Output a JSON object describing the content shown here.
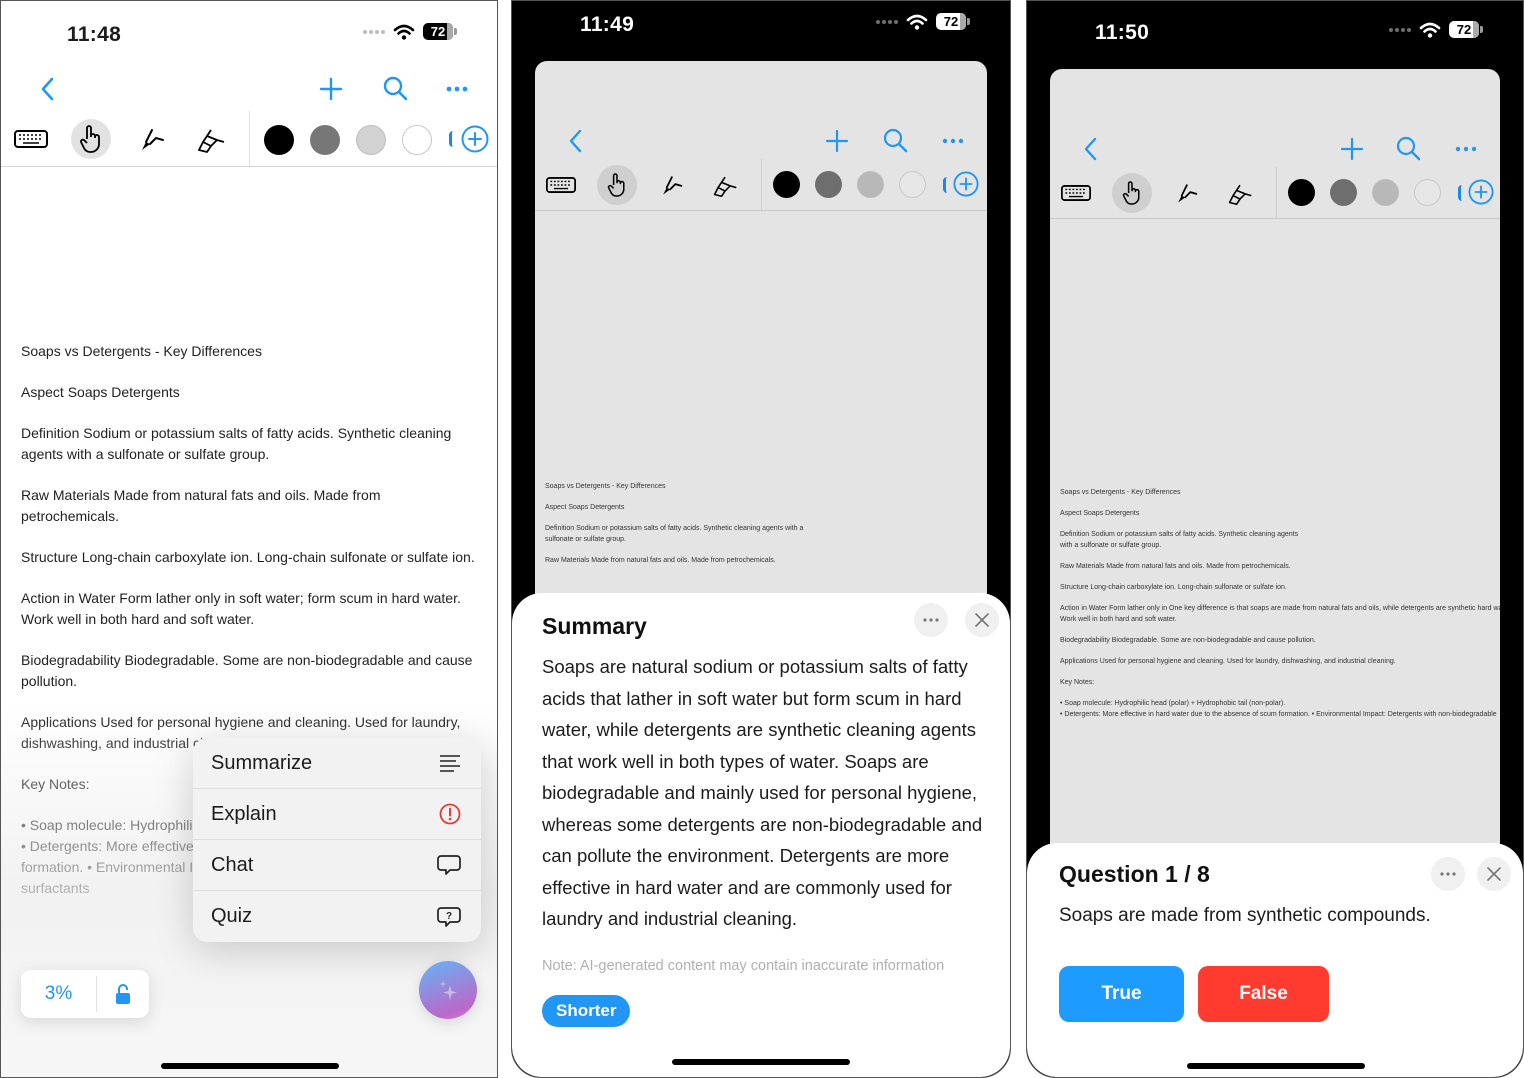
{
  "colors": {
    "accent": "#2196f3",
    "danger": "#ff3b30",
    "swatches": [
      "#000000",
      "#777777",
      "#cfcfcf",
      "#ffffff"
    ]
  },
  "document": {
    "title": "Soaps vs Detergents - Key Differences",
    "paragraphs": [
      "Soaps vs Detergents - Key Differences",
      "Aspect Soaps Detergents",
      "Definition Sodium or potassium salts of fatty acids. Synthetic cleaning agents with a sulfonate or sulfate group.",
      "Raw Materials Made from natural fats and oils. Made from petrochemicals.",
      "Structure Long-chain carboxylate ion. Long-chain sulfonate or sulfate ion.",
      "Action in Water Form lather only in soft water; form scum in hard water. Work well in both hard and soft water.",
      "Biodegradability Biodegradable. Some are non-biodegradable and cause pollution.",
      "Applications Used for personal hygiene and cleaning. Used for laundry, dishwashing, and industrial cleaning.",
      "Key Notes:",
      "• Soap molecule: Hydrophilic head (polar) + Hydrophobic tail (non-polar).\n• Detergents: More effective in hard water due to the absence of scum formation. • Environmental Impact: Detergents with non-biodegradable surfactants"
    ],
    "p3_paragraphs": [
      "Soaps vs Detergents - Key Differences",
      "Aspect Soaps Detergents",
      "Definition Sodium or potassium salts of fatty acids. Synthetic cleaning agents with a sulfonate or sulfate group.",
      "Raw Materials Made from natural fats and oils. Made from petrochemicals.",
      "Structure Long-chain carboxylate ion. Long-chain sulfonate or sulfate ion.",
      "Action in Water Form lather only in One key difference is that soaps are made from natural fats and oils, while detergents are synthetic hard water. Work well in both hard and soft water.",
      "Biodegradability Biodegradable. Some are non-biodegradable and cause pollution.",
      "Applications Used for personal hygiene and cleaning. Used for laundry, dishwashing, and industrial cleaning.",
      "Key Notes:",
      "• Soap molecule: Hydrophilic head (polar) + Hydrophobic tail (non-polar).\n• Detergents: More effective in hard water due to the absence of scum formation. • Environmental Impact: Detergents with non-biodegradable"
    ]
  },
  "screen1": {
    "time": "11:48",
    "battery": "72",
    "ai_menu": [
      {
        "label": "Summarize",
        "icon": "text-align-left-icon"
      },
      {
        "label": "Explain",
        "icon": "exclamation-circle-icon"
      },
      {
        "label": "Chat",
        "icon": "chat-bubble-icon"
      },
      {
        "label": "Quiz",
        "icon": "question-bubble-icon"
      }
    ],
    "zoom_level": "3%"
  },
  "screen2": {
    "time": "11:49",
    "battery": "72",
    "summary": {
      "title": "Summary",
      "body": "Soaps are natural sodium or potassium salts of fatty acids that lather in soft water but form scum in hard water, while detergents are synthetic cleaning agents that work well in both types of water. Soaps are biodegradable and mainly used for personal hygiene, whereas some detergents are non-biodegradable and can pollute the environment. Detergents are more effective in hard water and are commonly used for laundry and industrial cleaning.",
      "note": "Note: AI-generated content may contain inaccurate information",
      "shorter_label": "Shorter"
    }
  },
  "screen3": {
    "time": "11:50",
    "battery": "72",
    "quiz": {
      "title": "Question 1 / 8",
      "question": "Soaps are made from synthetic compounds.",
      "true_label": "True",
      "false_label": "False"
    }
  }
}
